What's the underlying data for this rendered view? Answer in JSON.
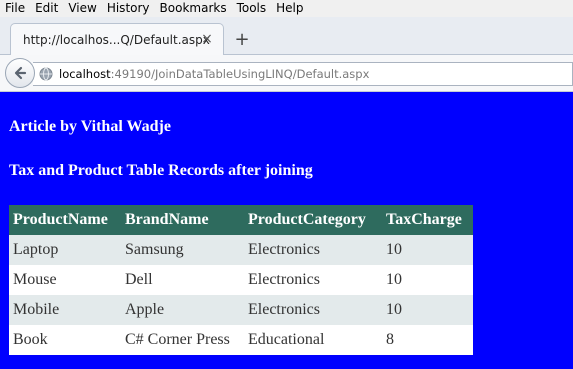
{
  "menubar": {
    "items": [
      "File",
      "Edit",
      "View",
      "History",
      "Bookmarks",
      "Tools",
      "Help"
    ]
  },
  "tab": {
    "title": "http://localhos...Q/Default.aspx",
    "close_glyph": "×",
    "new_tab_glyph": "+"
  },
  "address": {
    "host": "localhost",
    "rest": ":49190/JoinDataTableUsingLINQ/Default.aspx"
  },
  "page": {
    "heading1": "Article by Vithal Wadje",
    "heading2": "Tax and Product Table Records after joining",
    "background": "#0000ff"
  },
  "table": {
    "columns": [
      "ProductName",
      "BrandName",
      "ProductCategory",
      "TaxCharge"
    ],
    "rows": [
      [
        "Laptop",
        "Samsung",
        "Electronics",
        "10"
      ],
      [
        "Mouse",
        "Dell",
        "Electronics",
        "10"
      ],
      [
        "Mobile",
        "Apple",
        "Electronics",
        "10"
      ],
      [
        "Book",
        "C# Corner Press",
        "Educational",
        "8"
      ]
    ],
    "header_color": "#2e6b5e",
    "alt_row_color": "#e3eaeb"
  }
}
